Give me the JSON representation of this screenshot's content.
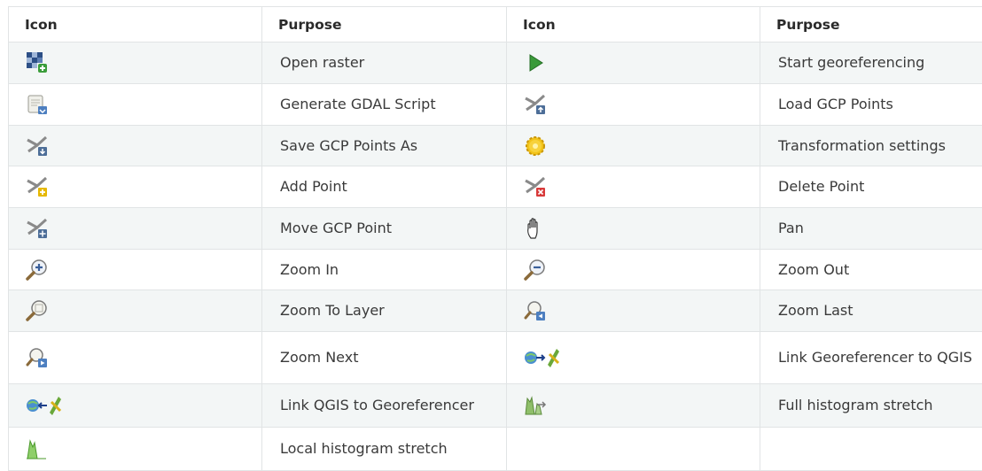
{
  "headers": [
    "Icon",
    "Purpose",
    "Icon",
    "Purpose"
  ],
  "rows": [
    {
      "left_icon": "open-raster-icon",
      "left_label": "Open raster",
      "right_icon": "start-georeferencing-icon",
      "right_label": "Start georeferencing"
    },
    {
      "left_icon": "generate-gdal-script-icon",
      "left_label": "Generate GDAL Script",
      "right_icon": "load-gcp-points-icon",
      "right_label": "Load GCP Points"
    },
    {
      "left_icon": "save-gcp-points-icon",
      "left_label": "Save GCP Points As",
      "right_icon": "transformation-settings-icon",
      "right_label": "Transformation settings"
    },
    {
      "left_icon": "add-point-icon",
      "left_label": "Add Point",
      "right_icon": "delete-point-icon",
      "right_label": "Delete Point"
    },
    {
      "left_icon": "move-gcp-point-icon",
      "left_label": "Move GCP Point",
      "right_icon": "pan-icon",
      "right_label": "Pan"
    },
    {
      "left_icon": "zoom-in-icon",
      "left_label": "Zoom In",
      "right_icon": "zoom-out-icon",
      "right_label": "Zoom Out"
    },
    {
      "left_icon": "zoom-to-layer-icon",
      "left_label": "Zoom To Layer",
      "right_icon": "zoom-last-icon",
      "right_label": "Zoom Last"
    },
    {
      "left_icon": "zoom-next-icon",
      "left_label": "Zoom Next",
      "right_icon": "link-georeferencer-to-qgis-icon",
      "right_label": "Link Georeferencer to QGIS"
    },
    {
      "left_icon": "link-qgis-to-georeferencer-icon",
      "left_label": "Link QGIS to Georeferencer",
      "right_icon": "full-histogram-stretch-icon",
      "right_label": "Full histogram stretch"
    },
    {
      "left_icon": "local-histogram-stretch-icon",
      "left_label": "Local histogram stretch",
      "right_icon": "",
      "right_label": ""
    }
  ]
}
